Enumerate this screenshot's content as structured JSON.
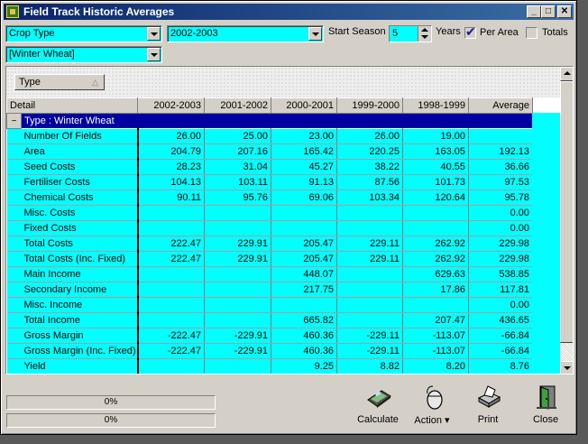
{
  "window": {
    "title": "Field Track Historic Averages"
  },
  "titlebar_buttons": {
    "minimize": "_",
    "maximize": "□",
    "close": "✕"
  },
  "filters": {
    "group_field": "Crop Type",
    "group_value": "[Winter Wheat]",
    "season": "2002-2003",
    "start_season_label": "Start Season",
    "years_value": "5",
    "years_label": "Years",
    "per_area_label": "Per Area",
    "per_area_checked": true,
    "totals_label": "Totals",
    "totals_checked": false
  },
  "group_panel": {
    "chip_label": "Type",
    "sort_icon": "△"
  },
  "grid": {
    "columns": [
      "Detail",
      "2002-2003",
      "2001-2002",
      "2000-2001",
      "1999-2000",
      "1998-1999",
      "Average"
    ],
    "group_label": "Type : Winter Wheat",
    "expander": "−",
    "rows": [
      [
        "Number Of Fields",
        "26.00",
        "25.00",
        "23.00",
        "26.00",
        "19.00",
        ""
      ],
      [
        "Area",
        "204.79",
        "207.16",
        "165.42",
        "220.25",
        "163.05",
        "192.13"
      ],
      [
        "Seed Costs",
        "28.23",
        "31.04",
        "45.27",
        "38.22",
        "40.55",
        "36.66"
      ],
      [
        "Fertiliser Costs",
        "104.13",
        "103.11",
        "91.13",
        "87.56",
        "101.73",
        "97.53"
      ],
      [
        "Chemical Costs",
        "90.11",
        "95.76",
        "69.06",
        "103.34",
        "120.64",
        "95.78"
      ],
      [
        "Misc. Costs",
        "",
        "",
        "",
        "",
        "",
        "0.00"
      ],
      [
        "Fixed Costs",
        "",
        "",
        "",
        "",
        "",
        "0.00"
      ],
      [
        "Total Costs",
        "222.47",
        "229.91",
        "205.47",
        "229.11",
        "262.92",
        "229.98"
      ],
      [
        "Total Costs (Inc. Fixed)",
        "222.47",
        "229.91",
        "205.47",
        "229.11",
        "262.92",
        "229.98"
      ],
      [
        "Main Income",
        "",
        "",
        "448.07",
        "",
        "629.63",
        "538.85"
      ],
      [
        "Secondary Income",
        "",
        "",
        "217.75",
        "",
        "17.86",
        "117.81"
      ],
      [
        "Misc. Income",
        "",
        "",
        "",
        "",
        "",
        "0.00"
      ],
      [
        "Total Income",
        "",
        "",
        "665.82",
        "",
        "207.47",
        "436.65"
      ],
      [
        "Gross Margin",
        "-222.47",
        "-229.91",
        "460.36",
        "-229.11",
        "-113.07",
        "-66.84"
      ],
      [
        "Gross Margin (Inc. Fixed)",
        "-222.47",
        "-229.91",
        "460.36",
        "-229.11",
        "-113.07",
        "-66.84"
      ],
      [
        "Yield",
        "",
        "",
        "9.25",
        "8.82",
        "8.20",
        "8.76"
      ]
    ]
  },
  "progress": {
    "bar1": "0%",
    "bar2": "0%"
  },
  "toolbar": {
    "calculate": "Calculate",
    "action": "Action",
    "action_arrow": "▾",
    "print": "Print",
    "close": "Close"
  },
  "colors": {
    "grid_bg": "#00ffff",
    "group_row": "#0000a0",
    "title_start": "#0a246a",
    "title_end": "#3a6ea5"
  }
}
